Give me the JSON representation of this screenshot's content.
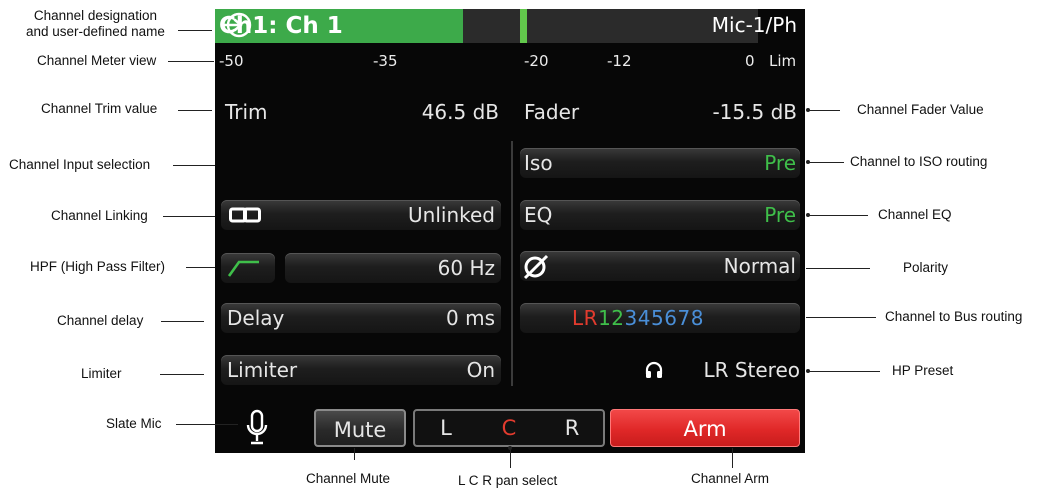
{
  "screen": {
    "channel_name": "Ch1: Ch 1",
    "meter_scale": [
      "-50",
      "-35",
      "-20",
      "-12",
      "0",
      "Lim"
    ],
    "trim": {
      "label": "Trim",
      "value": "46.5 dB"
    },
    "fader": {
      "label": "Fader",
      "value": "-15.5 dB"
    },
    "input": {
      "value": "Mic-1/Ph"
    },
    "linking": {
      "value": "Unlinked"
    },
    "hpf": {
      "value": "60 Hz"
    },
    "delay": {
      "label": "Delay",
      "value": "0 ms"
    },
    "limiter": {
      "label": "Limiter",
      "value": "On"
    },
    "iso": {
      "label": "Iso",
      "value": "Pre"
    },
    "eq": {
      "label": "EQ",
      "value": "Pre"
    },
    "polarity": {
      "value": "Normal"
    },
    "bus_routing": [
      {
        "text": "L",
        "color": "#e23b2e"
      },
      {
        "text": "R",
        "color": "#e23b2e"
      },
      {
        "text": "1",
        "color": "#3fbf4a"
      },
      {
        "text": "2",
        "color": "#3fbf4a"
      },
      {
        "text": "3",
        "color": "#4a8fd8"
      },
      {
        "text": "4",
        "color": "#4a8fd8"
      },
      {
        "text": "5",
        "color": "#4a8fd8"
      },
      {
        "text": "6",
        "color": "#4a8fd8"
      },
      {
        "text": "7",
        "color": "#4a8fd8"
      },
      {
        "text": "8",
        "color": "#4a8fd8"
      }
    ],
    "hp_preset": {
      "value": "LR Stereo"
    },
    "mute_label": "Mute",
    "pan": {
      "left": "L",
      "center": "C",
      "right": "R"
    },
    "arm_label": "Arm"
  },
  "callouts": {
    "channel_designation": "Channel designation\nand user-defined name",
    "meter_view": "Channel Meter view",
    "trim_value": "Channel Trim value",
    "input_selection": "Channel Input selection",
    "linking": "Channel Linking",
    "hpf": "HPF (High Pass Filter)",
    "delay": "Channel delay",
    "limiter": "Limiter",
    "slate_mic": "Slate Mic",
    "fader_value": "Channel Fader Value",
    "iso_routing": "Channel to ISO routing",
    "eq": "Channel EQ",
    "polarity": "Polarity",
    "bus_routing": "Channel to Bus routing",
    "hp_preset": "HP Preset",
    "mute": "Channel Mute",
    "pan_select": "L C R pan select",
    "arm": "Channel Arm"
  },
  "colors": {
    "accent_green": "#3daa4a",
    "input_blue": "#2f52b8",
    "arm_red": "#e02828"
  },
  "icons": [
    "input-icon",
    "link-icon",
    "hpf-curve-icon",
    "polarity-icon",
    "headphones-icon",
    "microphone-icon"
  ]
}
